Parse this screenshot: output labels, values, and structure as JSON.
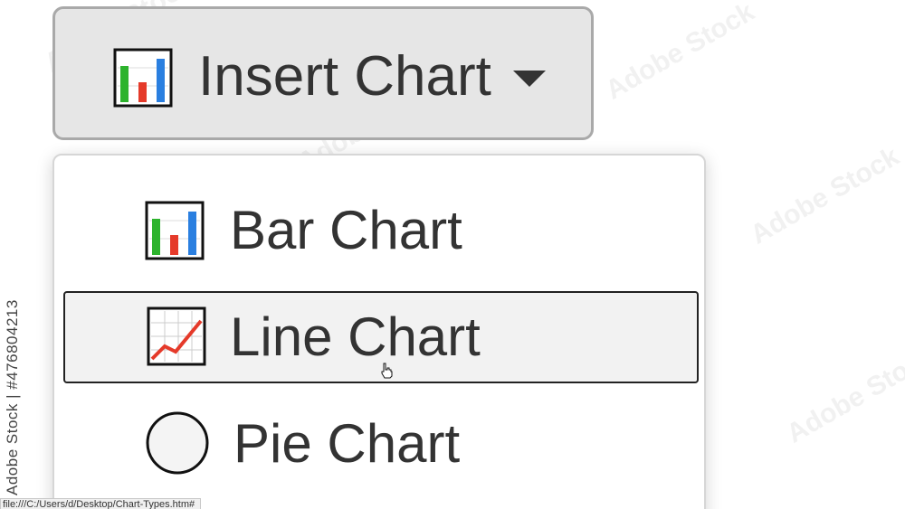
{
  "insert_button": {
    "label": "Insert Chart",
    "icon": "bar-chart-icon",
    "caret_icon": "caret-down-icon"
  },
  "menu": {
    "items": [
      {
        "label": "Bar Chart",
        "icon": "bar-chart-icon",
        "hovered": false
      },
      {
        "label": "Line Chart",
        "icon": "line-chart-icon",
        "hovered": true
      },
      {
        "label": "Pie Chart",
        "icon": "pie-chart-icon",
        "hovered": false
      }
    ]
  },
  "watermark": {
    "side_text": "Adobe Stock | #476804213",
    "pattern_text": "Adobe Stock"
  },
  "status_bar": {
    "url": "file:///C:/Users/d/Desktop/Chart-Types.htm#"
  },
  "colors": {
    "bar_green": "#2db32d",
    "bar_red": "#e53a2a",
    "bar_blue": "#2a7fe0",
    "button_bg": "#e6e6e6",
    "hover_bg": "#f2f2f2",
    "text": "#333333"
  }
}
